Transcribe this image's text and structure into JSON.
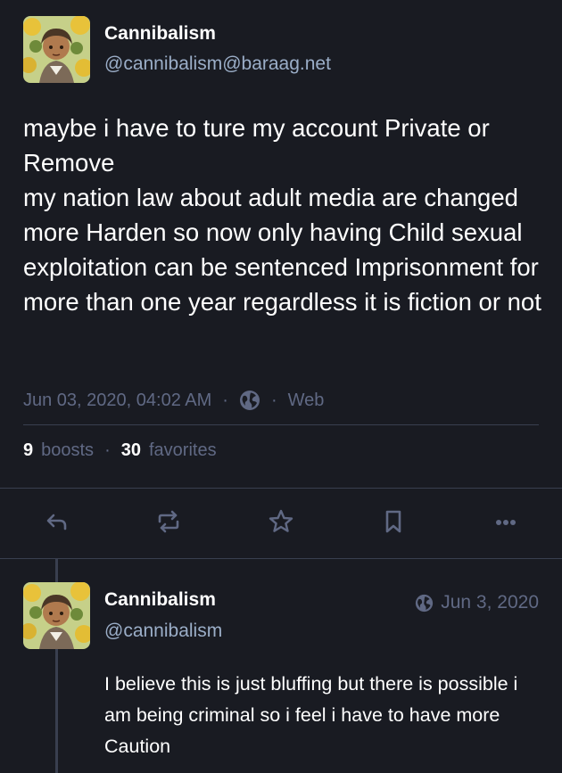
{
  "status": {
    "author": {
      "display_name": "Cannibalism",
      "handle": "@cannibalism@baraag.net"
    },
    "content": [
      "maybe i have to ture my account Private or Remove",
      "my nation law about adult media are changed more Harden so now only having Child sexual exploitation can be sentenced Imprisonment for more than one year regardless it is fiction or not"
    ],
    "timestamp": "Jun 03, 2020, 04:02 AM",
    "visibility_icon": "globe-icon",
    "application": "Web",
    "boosts_count": "9",
    "boosts_label": "boosts",
    "favorites_count": "30",
    "favorites_label": "favorites"
  },
  "action_bar": {
    "icons": [
      "reply-icon",
      "boost-icon",
      "favorite-icon",
      "bookmark-icon",
      "more-icon"
    ]
  },
  "reply": {
    "author": {
      "display_name": "Cannibalism",
      "handle": "@cannibalism"
    },
    "date": "Jun 3, 2020",
    "content": [
      "I believe this is just bluffing but there is possible i am being criminal so i feel i have to have more Caution"
    ]
  },
  "colors": {
    "background": "#191b22",
    "text": "#ffffff",
    "handle": "#9baec8",
    "muted": "#606984",
    "divider": "#393f4f"
  }
}
